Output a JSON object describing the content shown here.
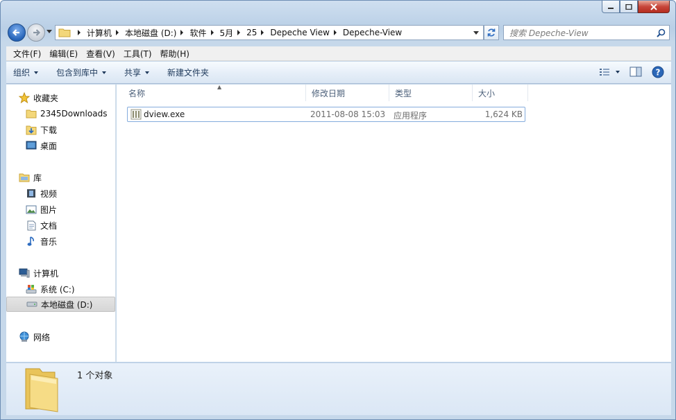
{
  "window": {
    "controls": {
      "minimize": "minimize",
      "maximize": "maximize",
      "close": "close"
    }
  },
  "address": {
    "crumbs": [
      "计算机",
      "本地磁盘 (D:)",
      "软件",
      "5月",
      "25",
      "Depeche View",
      "Depeche-View"
    ]
  },
  "search": {
    "placeholder": "搜索 Depeche-View"
  },
  "menu": [
    "文件(F)",
    "编辑(E)",
    "查看(V)",
    "工具(T)",
    "帮助(H)"
  ],
  "toolbar": {
    "organize": "组织",
    "include_in_library": "包含到库中",
    "share": "共享",
    "new_folder": "新建文件夹"
  },
  "nav": {
    "favorites": {
      "label": "收藏夹",
      "items": [
        "2345Downloads",
        "下载",
        "桌面"
      ]
    },
    "libraries": {
      "label": "库",
      "items": [
        "视频",
        "图片",
        "文档",
        "音乐"
      ]
    },
    "computer": {
      "label": "计算机",
      "items": [
        "系统 (C:)",
        "本地磁盘 (D:)"
      ]
    },
    "network": {
      "label": "网络"
    }
  },
  "columns": {
    "name": "名称",
    "modified": "修改日期",
    "type": "类型",
    "size": "大小"
  },
  "files": [
    {
      "name": "dview.exe",
      "modified": "2011-08-08 15:03",
      "type": "应用程序",
      "size": "1,624 KB"
    }
  ],
  "details": {
    "summary": "1 个对象"
  },
  "colors": {
    "accent": "#2563b8",
    "command_text": "#1e395b",
    "selection_border": "#84acdd"
  }
}
